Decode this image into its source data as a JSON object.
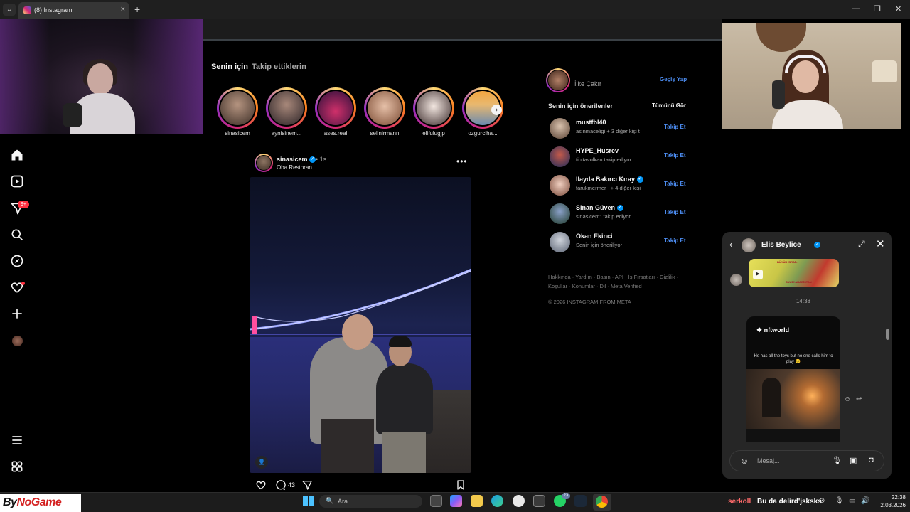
{
  "browser": {
    "tab_title": "(8) Instagram",
    "tab_close": "×",
    "new_tab": "+",
    "minimize": "—",
    "maximize": "❐",
    "close": "✕"
  },
  "feed": {
    "tabs": [
      "Senin için",
      "Takip ettiklerin"
    ]
  },
  "nav": {
    "notifications_badge": "9+"
  },
  "stories": [
    {
      "name": "sinasicem"
    },
    {
      "name": "aynisinem..."
    },
    {
      "name": "ases.real"
    },
    {
      "name": "selinirmann"
    },
    {
      "name": "elifulugjp"
    },
    {
      "name": "ozgurciha..."
    }
  ],
  "post": {
    "username": "sinasicem",
    "time": "• 1s",
    "location": "Oba Restoran",
    "more": "•••",
    "comment_count": "43"
  },
  "sidebar_right": {
    "current_user": "İlke Çakır",
    "switch_label": "Geçiş Yap",
    "suggestions_title": "Senin için önerilenler",
    "see_all": "Tümünü Gör",
    "suggestions": [
      {
        "name": "mustfbl40",
        "sub": "asinmaceligi + 3 diğer kişi t",
        "follow": "Takip Et",
        "verified": false
      },
      {
        "name": "HYPE_Husrev",
        "sub": "tinitavolkan takip ediyor",
        "follow": "Takip Et",
        "verified": false
      },
      {
        "name": "İlayda Bakırcı Kıray",
        "sub": "farukmermer_ + 4 diğer kişi",
        "follow": "Takip Et",
        "verified": true
      },
      {
        "name": "Sinan Güven",
        "sub": "sinasicem'i takip ediyor",
        "follow": "Takip Et",
        "verified": true
      },
      {
        "name": "Okan Ekinci",
        "sub": "Senin için öneriliyor",
        "follow": "Takip Et",
        "verified": false
      }
    ],
    "footer_links": "Hakkında · Yardım · Basın · API · İş Fırsatları · Gizlilik · Koşullar · Konumlar · Dil · Meta Verified",
    "copyright": "© 2026 INSTAGRAM FROM META"
  },
  "chat": {
    "name": "Elis Beylice",
    "time_divider": "14:38",
    "reel_user": "nftworld",
    "reel_caption": "He has all the toys but no one calls him to play 😔",
    "map_label_1": "BÜYÜK İSRAİL",
    "map_label_2": "SUUDİ ARABİSTAN",
    "input_placeholder": "Mesaj..."
  },
  "taskbar": {
    "brand_part1": "By",
    "brand_part2": "NoGame",
    "search_label": "Ara",
    "whatsapp_badge": "23",
    "ticker_user": "serkoll",
    "ticker_message": "Bu da delird'jsksks",
    "time": "22:38",
    "date": "2.03.2026"
  },
  "colors": {
    "accent_blue": "#0095f6",
    "link_blue": "#4c8cf0",
    "notification_red": "#ff3040",
    "background": "#000000",
    "chat_background": "#262626"
  }
}
